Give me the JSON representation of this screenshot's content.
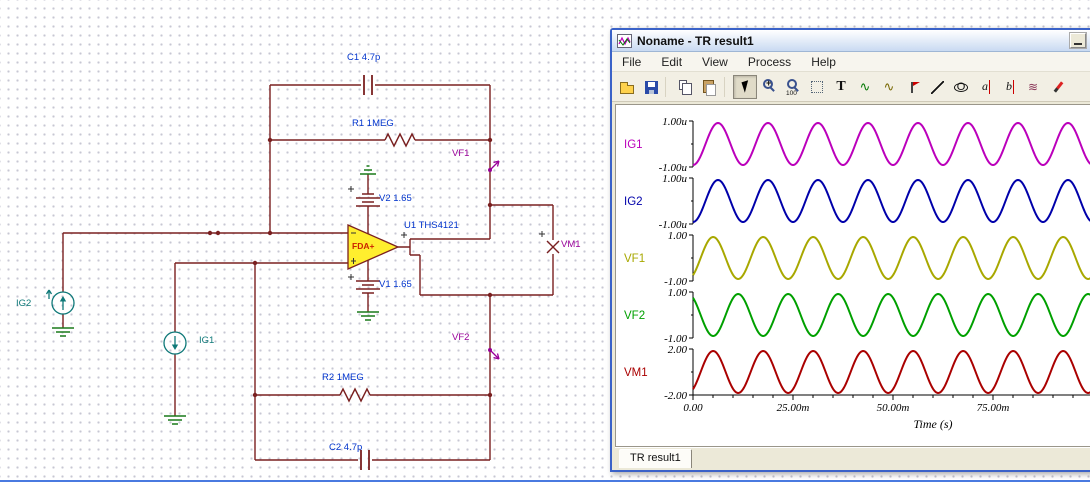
{
  "colors": {
    "wire": "#7a2020",
    "ground": "#1a7a1a",
    "component_label": "#0033cc",
    "probe_label": "#990099",
    "source_label": "#0e7878",
    "opamp_label": "#cc2200",
    "opamp_fill": "#ffee2e",
    "window_border": "#3a62c8"
  },
  "schematic": {
    "labels": [
      {
        "id": "c1",
        "text": "C1 4.7p",
        "role": "component"
      },
      {
        "id": "r1",
        "text": "R1 1MEG",
        "role": "component"
      },
      {
        "id": "vf1",
        "text": "VF1",
        "role": "probe"
      },
      {
        "id": "u1",
        "text": "U1 THS4121",
        "role": "component"
      },
      {
        "id": "fda",
        "text": "FDA+",
        "role": "opamp"
      },
      {
        "id": "v2",
        "text": "V2 1.65",
        "role": "component"
      },
      {
        "id": "v1",
        "text": "V1 1.65",
        "role": "component"
      },
      {
        "id": "vm1",
        "text": "VM1",
        "role": "probe"
      },
      {
        "id": "ig2",
        "text": "IG2",
        "role": "source"
      },
      {
        "id": "ig1",
        "text": "IG1",
        "role": "source"
      },
      {
        "id": "vf2",
        "text": "VF2",
        "role": "probe"
      },
      {
        "id": "r2",
        "text": "R2 1MEG",
        "role": "component"
      },
      {
        "id": "c2",
        "text": "C2 4.7p",
        "role": "component"
      }
    ]
  },
  "window": {
    "title": "Noname - TR result1",
    "menu_items": [
      "File",
      "Edit",
      "View",
      "Process",
      "Help"
    ],
    "toolbar_buttons": [
      {
        "name": "open",
        "glyph": ""
      },
      {
        "name": "save",
        "glyph": ""
      },
      {
        "name": "sep1",
        "separator": true
      },
      {
        "name": "copy",
        "glyph": ""
      },
      {
        "name": "paste",
        "glyph": ""
      },
      {
        "name": "sep2",
        "separator": true
      },
      {
        "name": "select-cursor",
        "glyph": "",
        "pressed": true
      },
      {
        "name": "zoom-in",
        "glyph": "+"
      },
      {
        "name": "zoom-100",
        "glyph": "100"
      },
      {
        "name": "interval",
        "glyph": ""
      },
      {
        "name": "text-tool",
        "glyph": "T"
      },
      {
        "name": "signal-edit",
        "glyph": "∿"
      },
      {
        "name": "signal-shift",
        "glyph": "∿"
      },
      {
        "name": "marker",
        "glyph": ""
      },
      {
        "name": "line-tool",
        "glyph": ""
      },
      {
        "name": "ellipse-tool",
        "glyph": "O"
      },
      {
        "name": "cursor-a",
        "glyph": "a"
      },
      {
        "name": "cursor-b",
        "glyph": "b"
      },
      {
        "name": "annotate",
        "glyph": "≋"
      },
      {
        "name": "pen",
        "glyph": ""
      }
    ],
    "tab_label": "TR result1"
  },
  "chart_data": {
    "type": "line",
    "title": "",
    "xlabel": "Time (s)",
    "grid": false,
    "legend": "none",
    "waveform": "sine",
    "period_ms": 12.5,
    "x_visible_range_ms": [
      0,
      100
    ],
    "x_ticks": [
      {
        "value_ms": 0,
        "label": "0.00"
      },
      {
        "value_ms": 25,
        "label": "25.00m"
      },
      {
        "value_ms": 50,
        "label": "50.00m"
      },
      {
        "value_ms": 75,
        "label": "75.00m"
      }
    ],
    "series": [
      {
        "name": "IG1",
        "color": "#bb00bb",
        "amplitude": "1u",
        "phase_deg": -90,
        "y_top_label": "1.00u",
        "y_bottom_label": "-1.00u"
      },
      {
        "name": "IG2",
        "color": "#0000aa",
        "amplitude": "1u",
        "phase_deg": -90,
        "y_top_label": "1.00u",
        "y_bottom_label": "-1.00u"
      },
      {
        "name": "VF1",
        "color": "#a8a800",
        "amplitude": "1",
        "phase_deg": -55,
        "y_top_label": "1.00",
        "y_bottom_label": "-1.00"
      },
      {
        "name": "VF2",
        "color": "#00a000",
        "amplitude": "1",
        "phase_deg": 125,
        "y_top_label": "1.00",
        "y_bottom_label": "-1.00"
      },
      {
        "name": "VM1",
        "color": "#aa0000",
        "amplitude": "2",
        "phase_deg": -55,
        "y_top_label": "2.00",
        "y_bottom_label": "-2.00"
      }
    ]
  }
}
